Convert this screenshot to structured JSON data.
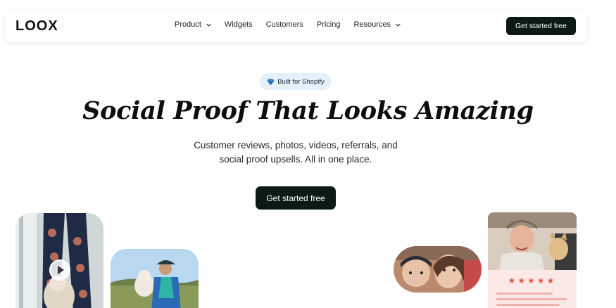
{
  "header": {
    "logo": "LOOX",
    "nav": [
      {
        "label": "Product",
        "has_dropdown": true
      },
      {
        "label": "Widgets",
        "has_dropdown": false
      },
      {
        "label": "Customers",
        "has_dropdown": false
      },
      {
        "label": "Pricing",
        "has_dropdown": false
      },
      {
        "label": "Resources",
        "has_dropdown": true
      }
    ],
    "cta_label": "Get started free"
  },
  "hero": {
    "badge_icon": "diamond-icon",
    "badge_label": "Built for Shopify",
    "title": "Social Proof That Looks Amazing",
    "subtitle_line1": "Customer reviews, photos, videos, referrals, and",
    "subtitle_line2": "social proof upsells. All in one place.",
    "cta_label": "Get started free"
  },
  "review_card": {
    "stars": "★★★★★",
    "rating": 5
  },
  "colors": {
    "cta_bg": "#0b1a14",
    "badge_bg": "#e6f0fa",
    "star": "#e05b4c",
    "review_bg": "#fbe9e7"
  }
}
